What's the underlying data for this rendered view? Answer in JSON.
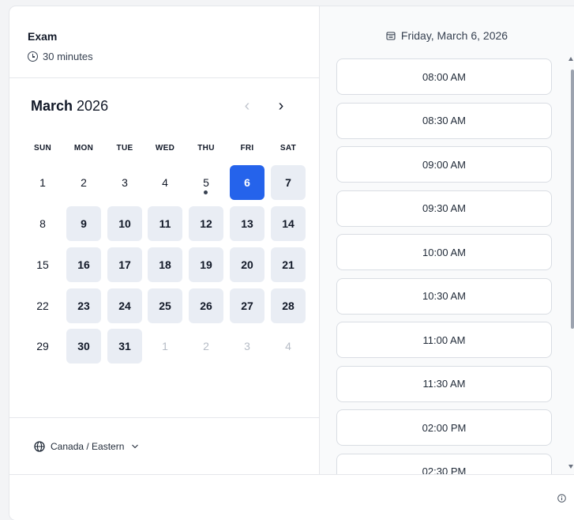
{
  "event": {
    "title": "Exam",
    "duration": "30 minutes",
    "duration_icon": "clock-icon"
  },
  "calendar": {
    "month": "March",
    "year": "2026",
    "prev_icon": "chevron-left-icon",
    "next_icon": "chevron-right-icon",
    "weekdays": [
      "SUN",
      "MON",
      "TUE",
      "WED",
      "THU",
      "FRI",
      "SAT"
    ],
    "weeks": [
      [
        {
          "label": "1",
          "state": "unavailable"
        },
        {
          "label": "2",
          "state": "unavailable"
        },
        {
          "label": "3",
          "state": "unavailable"
        },
        {
          "label": "4",
          "state": "unavailable"
        },
        {
          "label": "5",
          "state": "today"
        },
        {
          "label": "6",
          "state": "selected"
        },
        {
          "label": "7",
          "state": "available"
        }
      ],
      [
        {
          "label": "8",
          "state": "unavailable"
        },
        {
          "label": "9",
          "state": "available"
        },
        {
          "label": "10",
          "state": "available"
        },
        {
          "label": "11",
          "state": "available"
        },
        {
          "label": "12",
          "state": "available"
        },
        {
          "label": "13",
          "state": "available"
        },
        {
          "label": "14",
          "state": "available"
        }
      ],
      [
        {
          "label": "15",
          "state": "unavailable"
        },
        {
          "label": "16",
          "state": "available"
        },
        {
          "label": "17",
          "state": "available"
        },
        {
          "label": "18",
          "state": "available"
        },
        {
          "label": "19",
          "state": "available"
        },
        {
          "label": "20",
          "state": "available"
        },
        {
          "label": "21",
          "state": "available"
        }
      ],
      [
        {
          "label": "22",
          "state": "unavailable"
        },
        {
          "label": "23",
          "state": "available"
        },
        {
          "label": "24",
          "state": "available"
        },
        {
          "label": "25",
          "state": "available"
        },
        {
          "label": "26",
          "state": "available"
        },
        {
          "label": "27",
          "state": "available"
        },
        {
          "label": "28",
          "state": "available"
        }
      ],
      [
        {
          "label": "29",
          "state": "unavailable"
        },
        {
          "label": "30",
          "state": "available"
        },
        {
          "label": "31",
          "state": "available"
        },
        {
          "label": "1",
          "state": "other-month"
        },
        {
          "label": "2",
          "state": "other-month"
        },
        {
          "label": "3",
          "state": "other-month"
        },
        {
          "label": "4",
          "state": "other-month"
        }
      ]
    ]
  },
  "timezone": {
    "label": "Canada / Eastern",
    "icon": "globe-icon",
    "dropdown_icon": "chevron-down-icon"
  },
  "times": {
    "date_heading": "Friday, March 6, 2026",
    "date_icon": "calendar-icon",
    "slots": [
      "08:00 AM",
      "08:30 AM",
      "09:00 AM",
      "09:30 AM",
      "10:00 AM",
      "10:30 AM",
      "11:00 AM",
      "11:30 AM",
      "02:00 PM",
      "02:30 PM"
    ]
  },
  "footer": {
    "info_icon": "info-icon"
  },
  "colors": {
    "accent": "#2563eb",
    "available_bg": "#e9edf4",
    "border": "#e5e7eb"
  }
}
